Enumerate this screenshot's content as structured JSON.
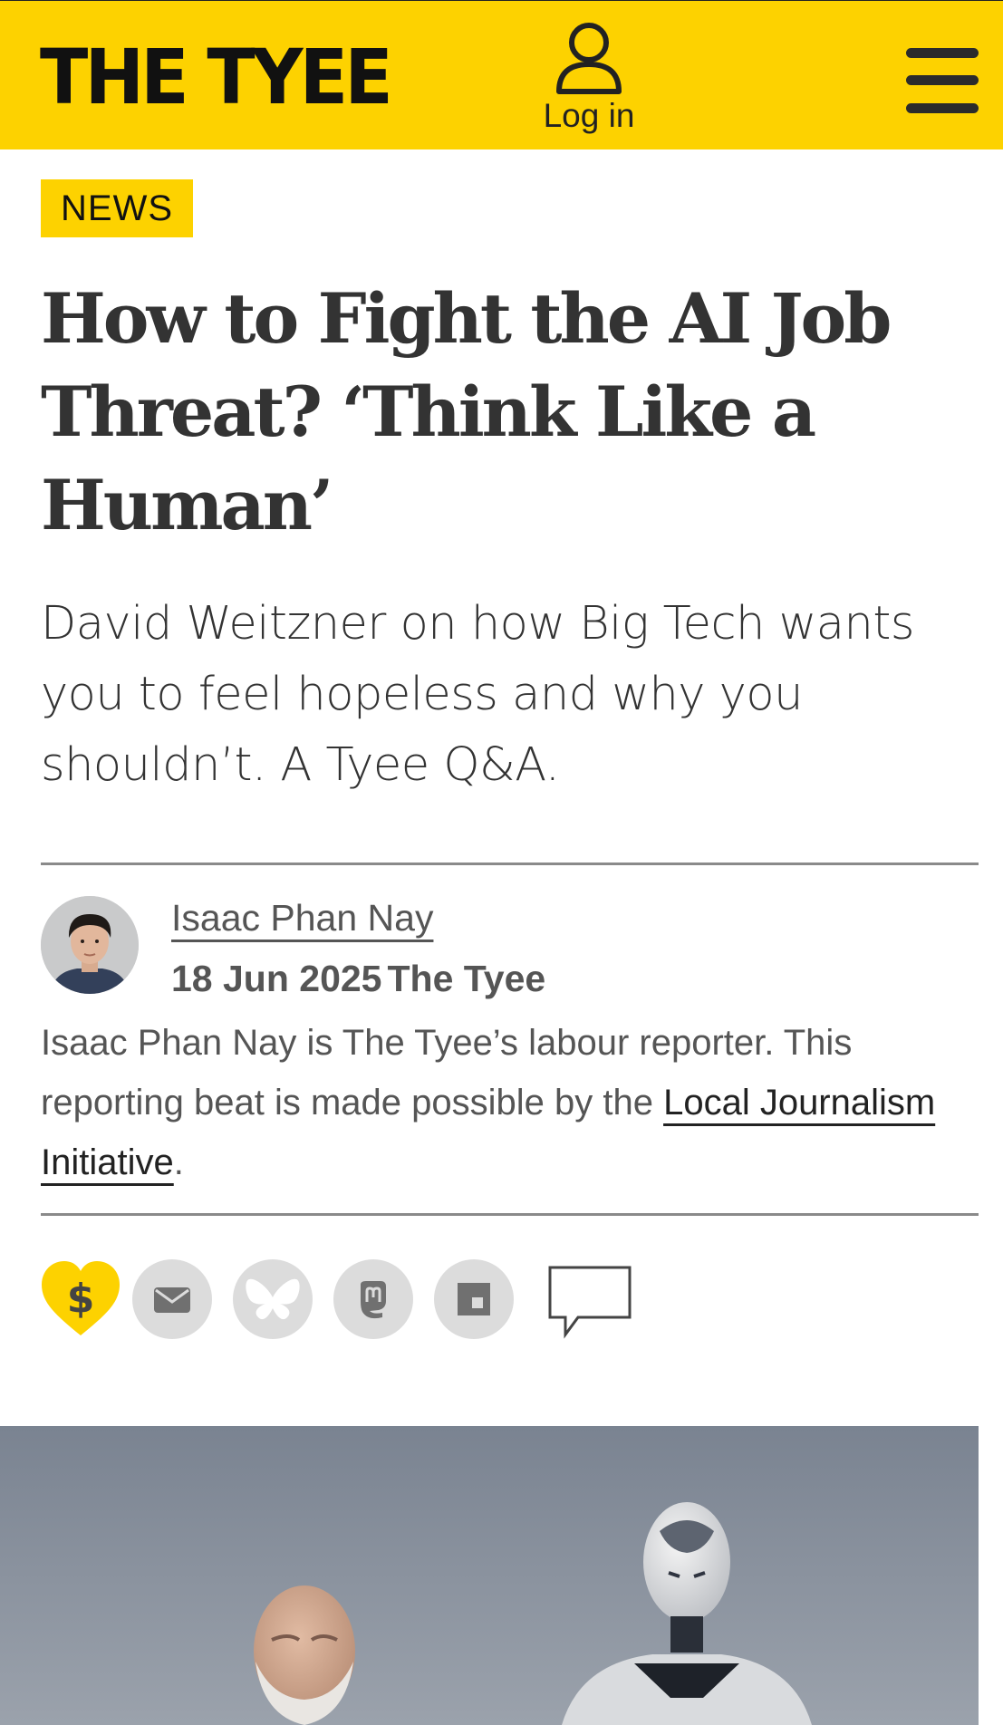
{
  "header": {
    "logo_text": "THE TYEE",
    "login_label": "Log in",
    "brand_color": "#fdd200"
  },
  "article": {
    "section_badge": "NEWS",
    "headline_line1": "How to Fight the AI Job",
    "headline_line2": "Threat? ‘Think Like a",
    "headline_line3": "Human’",
    "dek_line1": "David Weitzner on how Big Tech wants",
    "dek_line2": "you to feel hopeless and why you",
    "dek_line3": "shouldn’t. A Tyee Q&A."
  },
  "byline": {
    "author": "Isaac Phan Nay",
    "date": "18 Jun 2025",
    "publication": "The Tyee",
    "bio_text": "Isaac Phan Nay is The Tyee’s labour reporter. This reporting beat is made possible by the ",
    "bio_link": "Local Journalism Initiative",
    "bio_end": "."
  },
  "share": {
    "icons": [
      "donate-heart-icon",
      "email-icon",
      "bluesky-icon",
      "mastodon-icon",
      "flipboard-icon",
      "comment-icon"
    ]
  }
}
